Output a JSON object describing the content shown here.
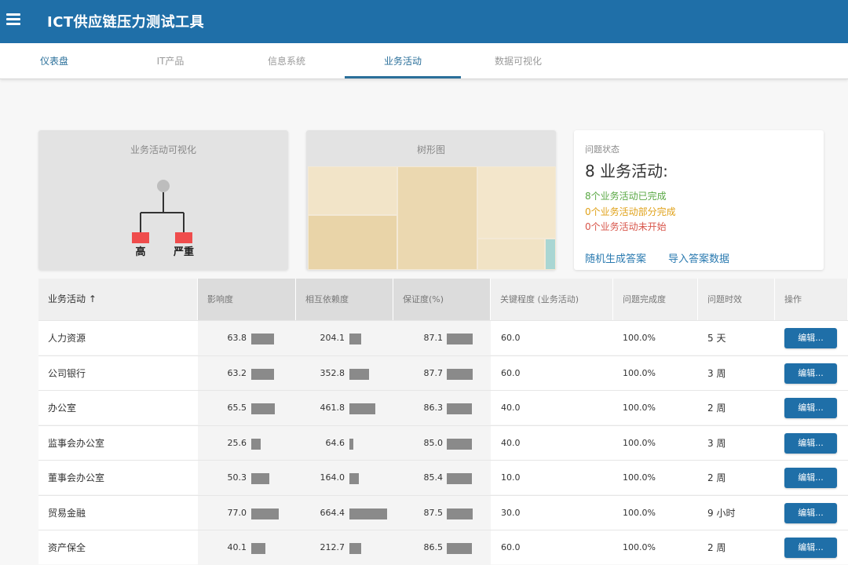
{
  "app": {
    "title": "ICT供应链压力测试工具"
  },
  "tabs": [
    {
      "label": "仪表盘"
    },
    {
      "label": "IT产品"
    },
    {
      "label": "信息系统"
    },
    {
      "label": "业务活动"
    },
    {
      "label": "数据可视化"
    }
  ],
  "active_tab": 3,
  "viz_card": {
    "title": "业务活动可视化",
    "nodes": [
      {
        "label": "高",
        "color": "#ef4c4c"
      },
      {
        "label": "严重",
        "color": "#ef4c4c"
      }
    ],
    "root_color": "#bdbdbd"
  },
  "tree_card": {
    "title": "树形图"
  },
  "status_card": {
    "label": "问题状态",
    "heading_count": "8",
    "heading_text": " 业务活动:",
    "done_count": "8",
    "done_text": "个业务活动已完成",
    "partial_count": "0",
    "partial_text": "个业务活动部分完成",
    "none_count": "0",
    "none_text": "个业务活动未开始",
    "link_random": "随机生成答案",
    "link_import": "导入答案数据"
  },
  "table": {
    "headers": [
      "业务活动 ↑",
      "影响度",
      "相互依赖度",
      "保证度(%)",
      "关键程度 (业务活动)",
      "问题完成度",
      "问题时效",
      "操作"
    ],
    "rows": [
      {
        "name": "人力资源",
        "impact": "63.8",
        "depend": "204.1",
        "assure": "87.1",
        "critical": "60.0",
        "complete": "100.0%",
        "timeliness": "5 天",
        "action": "编辑..."
      },
      {
        "name": "公司银行",
        "impact": "63.2",
        "depend": "352.8",
        "assure": "87.7",
        "critical": "60.0",
        "complete": "100.0%",
        "timeliness": "3 周",
        "action": "编辑..."
      },
      {
        "name": "办公室",
        "impact": "65.5",
        "depend": "461.8",
        "assure": "86.3",
        "critical": "40.0",
        "complete": "100.0%",
        "timeliness": "2 周",
        "action": "编辑..."
      },
      {
        "name": "监事会办公室",
        "impact": "25.6",
        "depend": "64.6",
        "assure": "85.0",
        "critical": "40.0",
        "complete": "100.0%",
        "timeliness": "3 周",
        "action": "编辑..."
      },
      {
        "name": "董事会办公室",
        "impact": "50.3",
        "depend": "164.0",
        "assure": "85.4",
        "critical": "10.0",
        "complete": "100.0%",
        "timeliness": "2 周",
        "action": "编辑..."
      },
      {
        "name": "贸易金融",
        "impact": "77.0",
        "depend": "664.4",
        "assure": "87.5",
        "critical": "30.0",
        "complete": "100.0%",
        "timeliness": "9 小时",
        "action": "编辑..."
      },
      {
        "name": "资产保全",
        "impact": "40.1",
        "depend": "212.7",
        "assure": "86.5",
        "critical": "60.0",
        "complete": "100.0%",
        "timeliness": "2 周",
        "action": "编辑..."
      }
    ]
  },
  "colors": {
    "header_bg": "#1f6fa8",
    "accent": "#2a6f9a",
    "bar": "#8a8a8a",
    "button": "#1f6fa8",
    "done": "#5aa845",
    "partial": "#e0a21a",
    "none": "#d8564b"
  }
}
